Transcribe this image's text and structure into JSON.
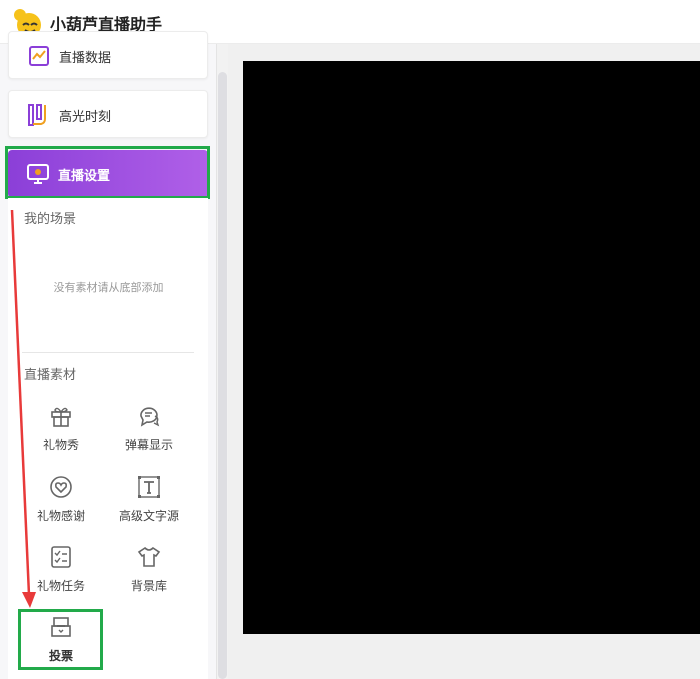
{
  "app": {
    "title": "小葫芦直播助手"
  },
  "nav": {
    "items": [
      {
        "label": "直播数据"
      },
      {
        "label": "高光时刻"
      },
      {
        "label": "直播设置"
      }
    ]
  },
  "scene": {
    "title": "我的场景",
    "empty_hint": "没有素材请从底部添加"
  },
  "materials": {
    "title": "直播素材",
    "tools": [
      {
        "label": "礼物秀",
        "icon": "gift-icon"
      },
      {
        "label": "弹幕显示",
        "icon": "chat-bubbles-icon"
      },
      {
        "label": "礼物感谢",
        "icon": "heart-circle-icon"
      },
      {
        "label": "高级文字源",
        "icon": "text-frame-icon"
      },
      {
        "label": "礼物任务",
        "icon": "checklist-icon"
      },
      {
        "label": "背景库",
        "icon": "tshirt-icon"
      },
      {
        "label": "投票",
        "icon": "ballot-box-icon"
      }
    ]
  },
  "colors": {
    "accent": "#9b4fe0",
    "highlight_box": "#22aa4a",
    "arrow": "#e83a3a",
    "preview_bg": "#000000"
  }
}
